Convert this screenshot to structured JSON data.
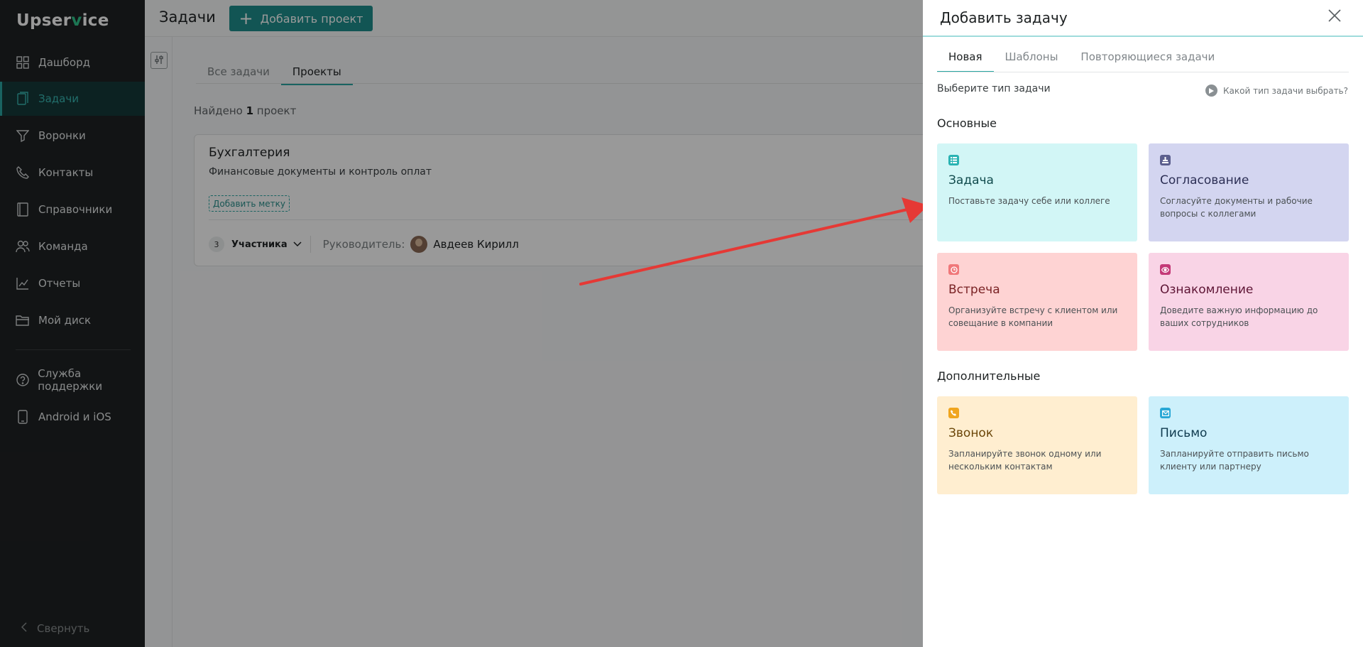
{
  "app": {
    "logo_pre": "Upser",
    "logo_check": "v",
    "logo_post": "ice"
  },
  "sidebar": {
    "items": [
      {
        "label": "Дашборд",
        "icon": "dashboard-icon"
      },
      {
        "label": "Задачи",
        "icon": "tasks-icon"
      },
      {
        "label": "Воронки",
        "icon": "funnel-icon"
      },
      {
        "label": "Контакты",
        "icon": "phone-icon"
      },
      {
        "label": "Справочники",
        "icon": "book-icon"
      },
      {
        "label": "Команда",
        "icon": "team-icon"
      },
      {
        "label": "Отчеты",
        "icon": "chart-icon"
      },
      {
        "label": "Мой диск",
        "icon": "folder-icon"
      }
    ],
    "support": {
      "label": "Служба поддержки",
      "icon": "help-circle-icon"
    },
    "mobile": {
      "label": "Android и iOS",
      "icon": "mobile-icon"
    },
    "collapse": {
      "label": "Свернуть",
      "icon": "chevron-left-icon"
    }
  },
  "main": {
    "title": "Задачи",
    "add_project": "Добавить проект",
    "tabs": [
      {
        "label": "Все задачи"
      },
      {
        "label": "Проекты"
      }
    ],
    "found_pre": "Найдено ",
    "found_count": "1",
    "found_post": " проект",
    "project": {
      "title": "Бухгалтерия",
      "description": "Финансовые документы и контроль оплат",
      "tag_button": "Добавить метку",
      "participants_count": "3",
      "participants_label": "Участника",
      "lead_label": "Руководитель:",
      "lead_name": "Авдеев Кирилл"
    }
  },
  "panel": {
    "title": "Добавить задачу",
    "tabs": [
      {
        "label": "Новая"
      },
      {
        "label": "Шаблоны"
      },
      {
        "label": "Повторяющиеся задачи"
      }
    ],
    "choose_label": "Выберите тип задачи",
    "help_link": "Какой тип задачи выбрать?",
    "section_main": "Основные",
    "section_extra": "Дополнительные",
    "cards": [
      {
        "name": "Задача",
        "desc": "Поставьте задачу себе или коллеге",
        "bg": "#d2f6f6",
        "accent": "#2ab3b3",
        "title_color": "#114b4d",
        "icon": "list-icon"
      },
      {
        "name": "Согласование",
        "desc": "Согласуйте документы и рабочие вопросы с коллегами",
        "bg": "#d3d5f0",
        "accent": "#5c5f8e",
        "title_color": "#2c2f55",
        "icon": "approve-icon"
      },
      {
        "name": "Встреча",
        "desc": "Организуйте встречу с клиентом или совещание в компании",
        "bg": "#fed3d3",
        "accent": "#f0787a",
        "title_color": "#7a2325",
        "icon": "clock-icon"
      },
      {
        "name": "Ознакомление",
        "desc": "Доведите важную информацию до ваших сотрудников",
        "bg": "#f9d4e6",
        "accent": "#c43a78",
        "title_color": "#5e1535",
        "icon": "eye-icon"
      },
      {
        "name": "Звонок",
        "desc": "Запланируйте звонок одному или нескольким контактам",
        "bg": "#ffeed0",
        "accent": "#f0a51f",
        "title_color": "#6a4508",
        "icon": "call-icon"
      },
      {
        "name": "Письмо",
        "desc": "Запланируйте отправить письмо клиенту или партнеру",
        "bg": "#cdf0fb",
        "accent": "#2aa8d6",
        "title_color": "#0f3a4e",
        "icon": "mail-icon"
      }
    ]
  },
  "annotation": {
    "arrow_color": "#e53935"
  }
}
